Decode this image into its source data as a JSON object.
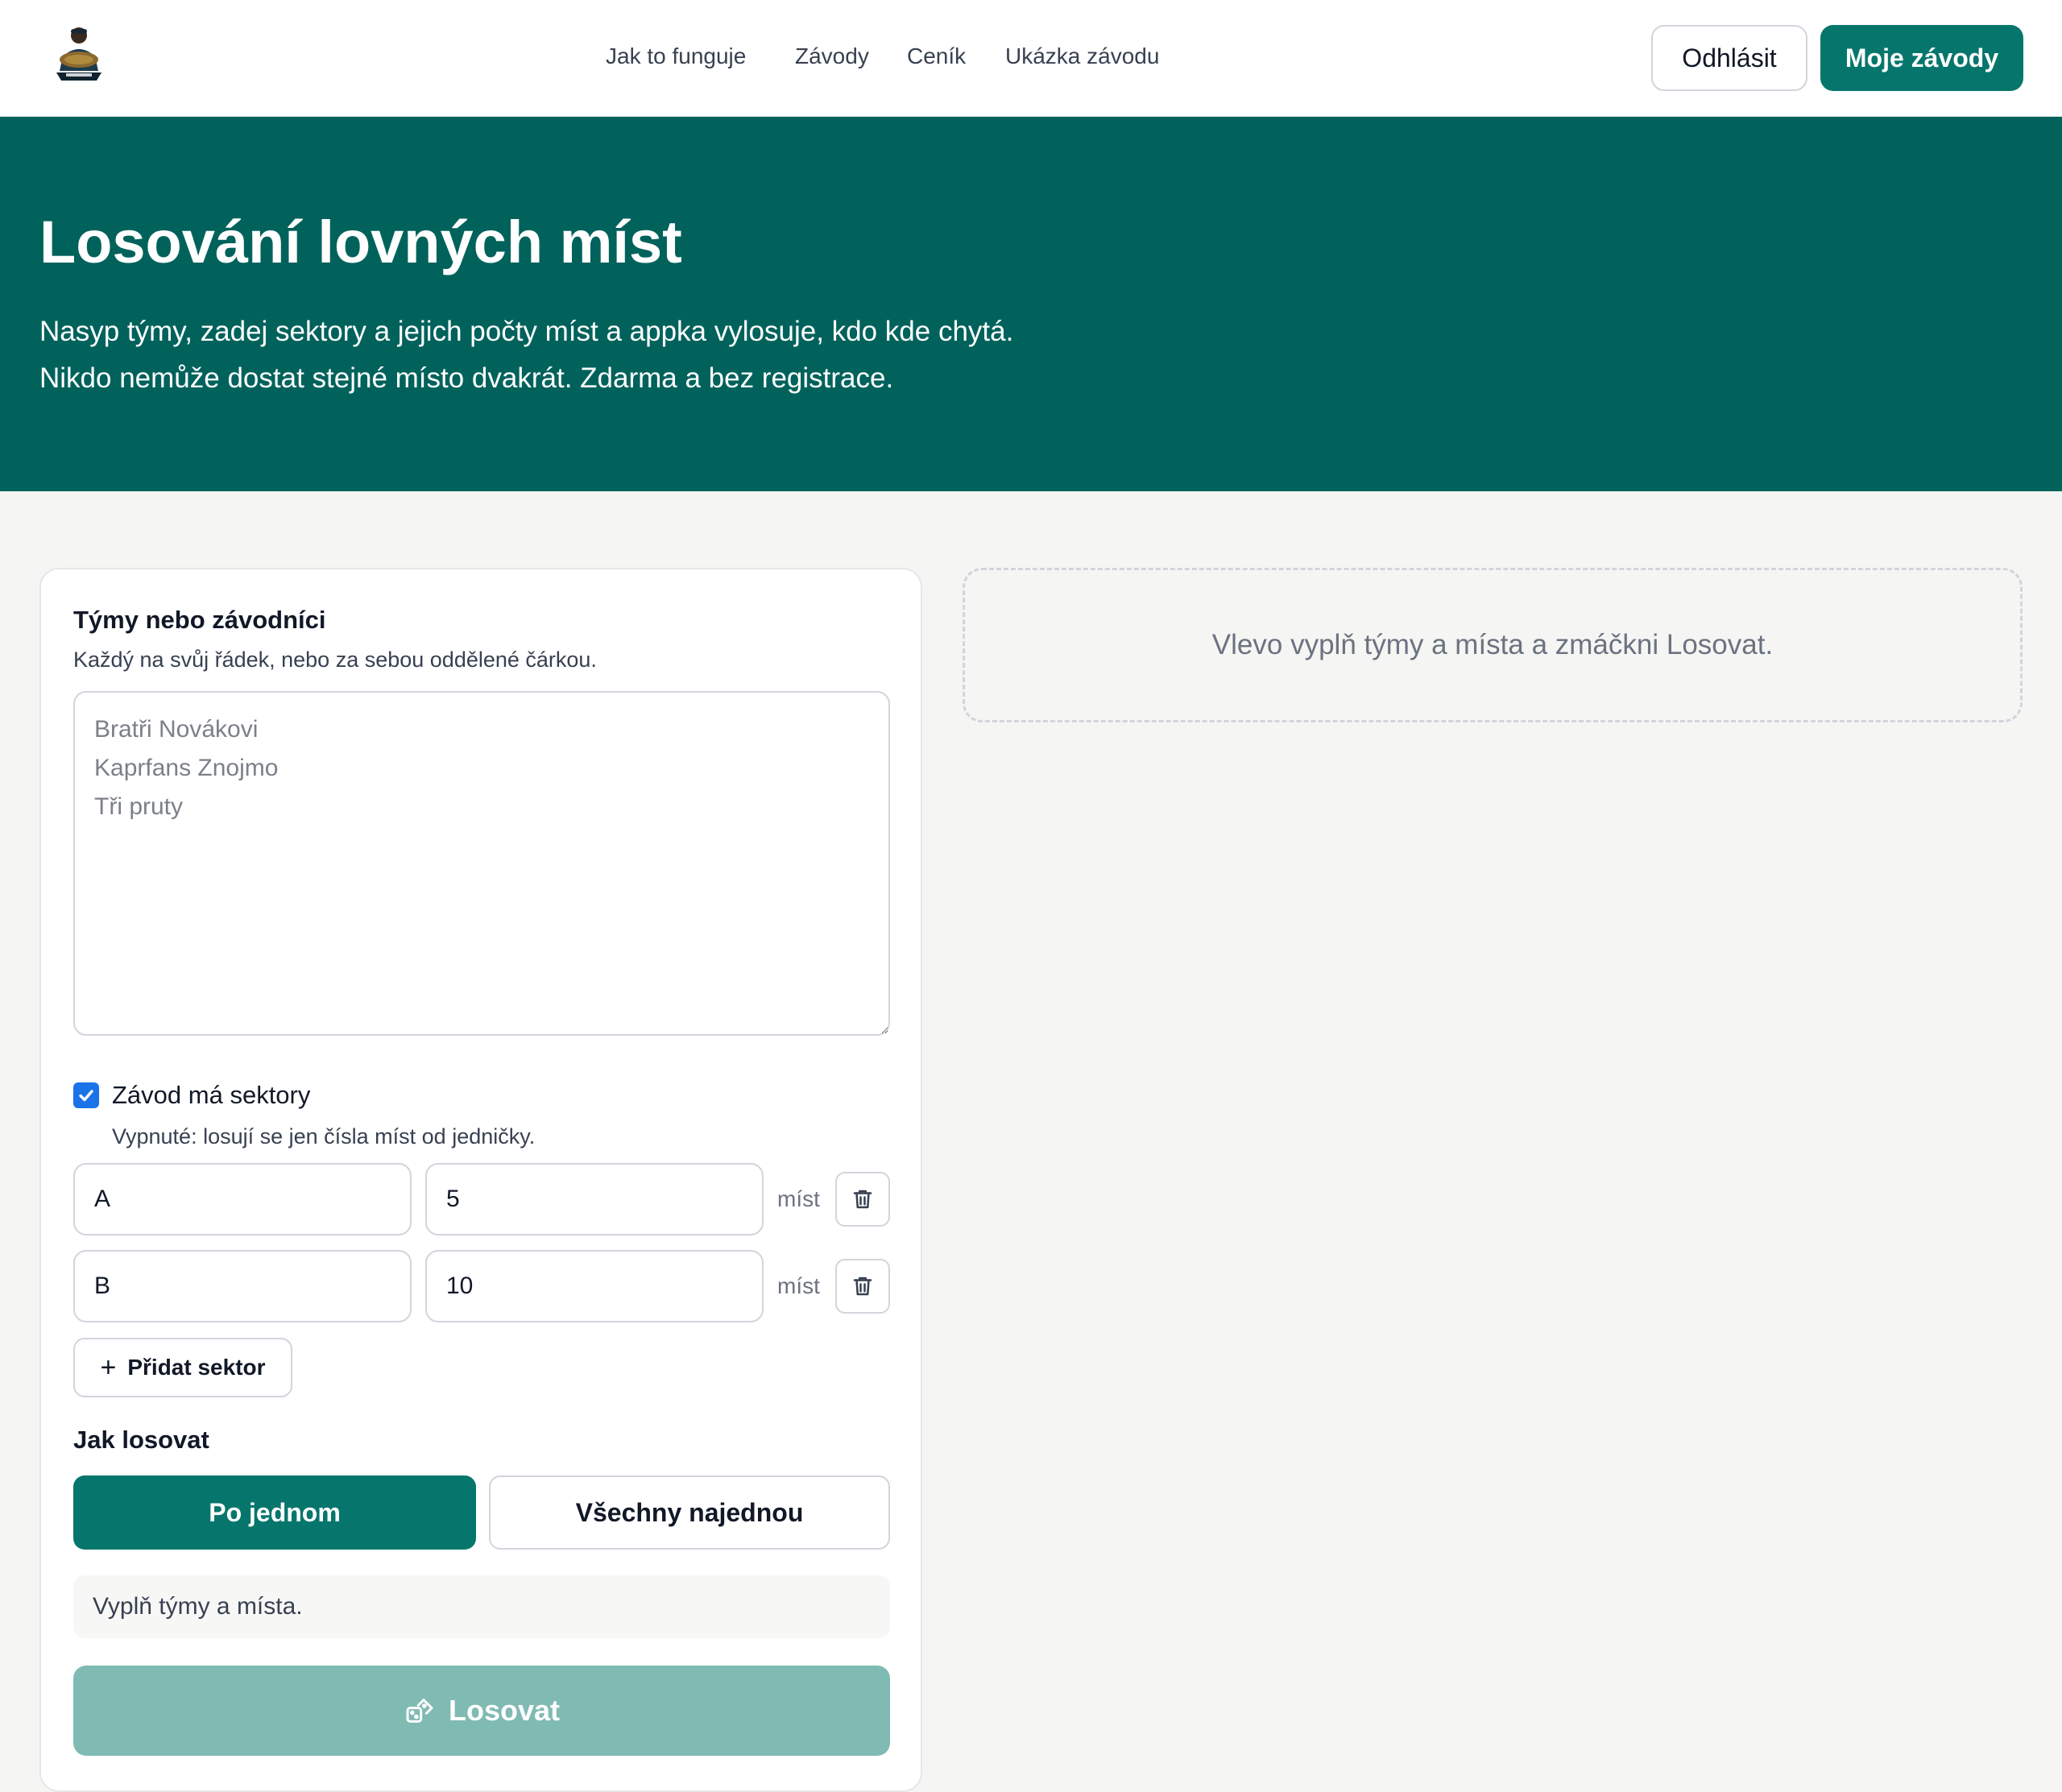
{
  "header": {
    "logo_icon": "fisherman-carp-logo-icon",
    "nav": [
      "Jak to funguje",
      "Závody",
      "Ceník",
      "Ukázka závodu"
    ],
    "logout_label": "Odhlásit",
    "my_races_label": "Moje závody"
  },
  "hero": {
    "title": "Losování lovných míst",
    "desc_line1": "Nasyp týmy, zadej sektory a jejich počty míst a appka vylosuje, kdo kde chytá.",
    "desc_line2": "Nikdo nemůže dostat stejné místo dvakrát. Zdarma a bez registrace."
  },
  "teams": {
    "title": "Týmy nebo závodníci",
    "hint": "Každý na svůj řádek, nebo za sebou oddělené čárkou.",
    "value": "",
    "placeholder": "Bratři Novákovi\nKaprfans Znojmo\nTři pruty"
  },
  "sectors": {
    "checkbox_label": "Závod má sektory",
    "checked": true,
    "hint": "Vypnuté: losují se jen čísla míst od jedničky.",
    "rows": [
      {
        "name": "A",
        "count": "5",
        "unit": "míst"
      },
      {
        "name": "B",
        "count": "10",
        "unit": "míst"
      }
    ],
    "add_label": "Přidat sektor"
  },
  "mode": {
    "title": "Jak losovat",
    "options": [
      "Po jednom",
      "Všechny najednou"
    ],
    "selected": "Po jednom"
  },
  "status": "Vyplň týmy a místa.",
  "draw_label": "Losovat",
  "result_placeholder": "Vlevo vyplň týmy a místa a zmáčkni Losovat.",
  "colors": {
    "header_bg": "#ffffff",
    "hero_bg": "#01625c",
    "accent": "#06766c",
    "accent_disabled": "#7fbab3",
    "page_bg": "#f5f5f3",
    "checkbox": "#1a73e8"
  }
}
